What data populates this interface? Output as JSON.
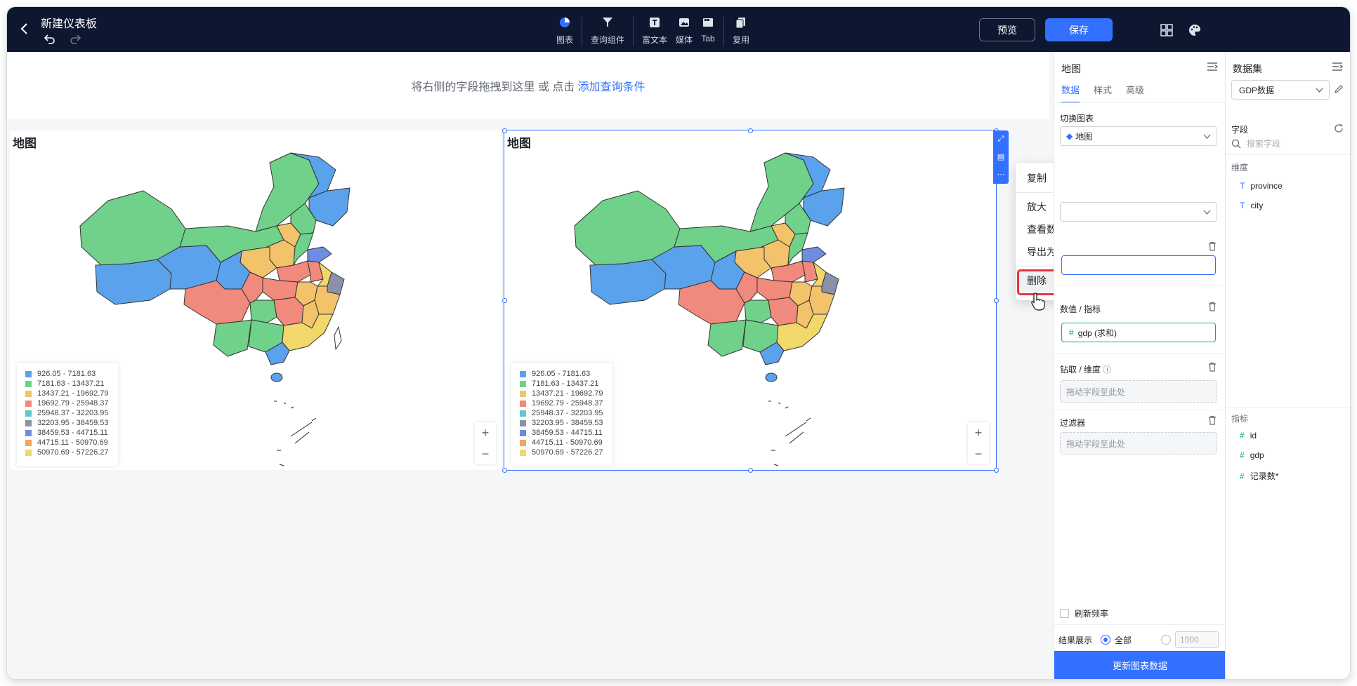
{
  "header": {
    "title": "新建仪表板",
    "tools": [
      {
        "label": "图表",
        "icon": "pie-chart-icon"
      },
      {
        "label": "查询组件",
        "icon": "filter-icon"
      },
      {
        "label": "富文本",
        "icon": "text-icon"
      },
      {
        "label": "媒体",
        "icon": "image-icon"
      },
      {
        "label": "Tab",
        "icon": "tab-icon"
      },
      {
        "label": "复用",
        "icon": "copy-icon"
      }
    ],
    "preview_label": "预览",
    "save_label": "保存"
  },
  "query_bar": {
    "text": "将右侧的字段拖拽到这里 或 点击",
    "link": "添加查询条件"
  },
  "charts": [
    {
      "title": "地图"
    },
    {
      "title": "地图"
    }
  ],
  "legend": [
    {
      "label": "926.05 - 7181.63",
      "color": "#5aa2ec"
    },
    {
      "label": "7181.63 - 13437.21",
      "color": "#6fd18a"
    },
    {
      "label": "13437.21 - 19692.79",
      "color": "#f2c36b"
    },
    {
      "label": "19692.79 - 25948.37",
      "color": "#f08a7c"
    },
    {
      "label": "25948.37 - 32203.95",
      "color": "#5ec9c6"
    },
    {
      "label": "32203.95 - 38459.53",
      "color": "#8a91a8"
    },
    {
      "label": "38459.53 - 44715.11",
      "color": "#6f8de0"
    },
    {
      "label": "44715.11 - 50970.69",
      "color": "#f3a55a"
    },
    {
      "label": "50970.69 - 57226.27",
      "color": "#f2d76a"
    }
  ],
  "context_menu": {
    "copy": "复制",
    "zoom": "放大",
    "view_data": "查看数据",
    "export": "导出为",
    "delete": "删除"
  },
  "props": {
    "title": "地图",
    "tabs": [
      "数据",
      "样式",
      "高级"
    ],
    "switch_chart_label": "切换图表",
    "chart_type": "地图",
    "metric_label": "数值 / 指标",
    "metric_field": "gdp (求和)",
    "drill_label": "钻取 / 维度",
    "drill_placeholder": "拖动字段至此处",
    "filter_label": "过滤器",
    "filter_placeholder": "拖动字段至此处",
    "refresh_label": "刷新频率",
    "result_label": "结果展示",
    "result_all": "全部",
    "result_count": "1000",
    "update_button": "更新图表数据"
  },
  "dataset": {
    "title": "数据集",
    "selected": "GDP数据",
    "field_label": "字段",
    "search_placeholder": "搜索字段",
    "dimension_label": "维度",
    "dimensions": [
      "province",
      "city"
    ],
    "metric_label": "指标",
    "metrics": [
      "id",
      "gdp",
      "记录数*"
    ]
  },
  "colors": {
    "accent": "#3370ff",
    "topbar": "#0d1730",
    "teal": "#16a394"
  }
}
